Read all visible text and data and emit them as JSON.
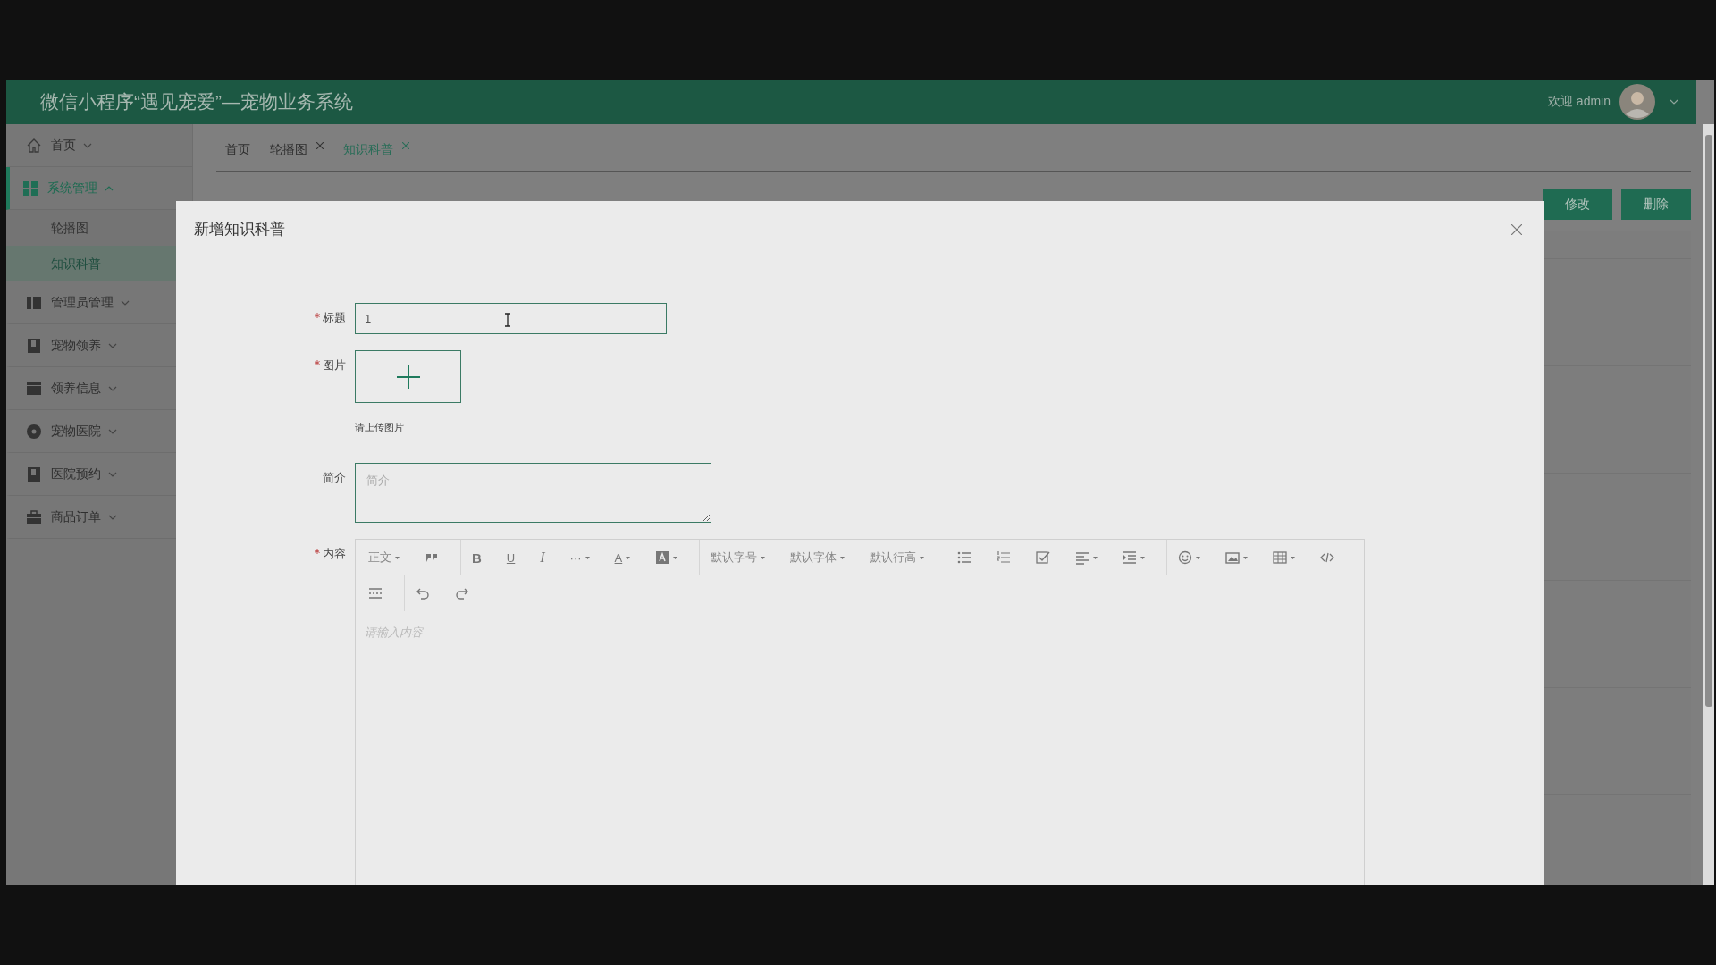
{
  "header": {
    "title": "微信小程序“遇见宠爱”—宠物业务系统",
    "welcome": "欢迎 admin"
  },
  "sidebar": {
    "items": [
      {
        "label": "首页",
        "selected": false,
        "expanded": false
      },
      {
        "label": "系统管理",
        "selected": true,
        "expanded": true,
        "children": [
          {
            "label": "轮播图",
            "selected": false
          },
          {
            "label": "知识科普",
            "selected": true
          }
        ]
      },
      {
        "label": "管理员管理",
        "selected": false,
        "expanded": false
      },
      {
        "label": "宠物领养",
        "selected": false,
        "expanded": false
      },
      {
        "label": "领养信息",
        "selected": false,
        "expanded": false
      },
      {
        "label": "宠物医院",
        "selected": false,
        "expanded": false
      },
      {
        "label": "医院预约",
        "selected": false,
        "expanded": false
      },
      {
        "label": "商品订单",
        "selected": false,
        "expanded": false
      }
    ]
  },
  "tabs": [
    {
      "label": "首页",
      "selected": false,
      "closable": false
    },
    {
      "label": "轮播图",
      "selected": false,
      "closable": true
    },
    {
      "label": "知识科普",
      "selected": true,
      "closable": true
    }
  ],
  "actions": [
    "修改",
    "删除"
  ],
  "dialog": {
    "title": "新增知识科普",
    "fields": [
      {
        "kind": "text",
        "label": "标题",
        "required": true,
        "value": "1"
      },
      {
        "kind": "upload",
        "label": "图片",
        "required": true,
        "hint": "请上传图片"
      },
      {
        "kind": "textarea",
        "label": "简介",
        "required": false,
        "placeholder": "简介"
      },
      {
        "kind": "editor",
        "label": "内容",
        "required": true,
        "placeholder": "请输入内容",
        "toolbar": [
          [
            {
              "kind": "dropdown",
              "label": "正文"
            },
            {
              "kind": "icon",
              "caret": false
            },
            {
              "kind": "separator"
            },
            {
              "kind": "glyph",
              "label": "B",
              "caret": false
            },
            {
              "kind": "glyph",
              "label": "U",
              "caret": false
            },
            {
              "kind": "glyph",
              "label": "I",
              "caret": false
            },
            {
              "kind": "glyph",
              "label": "···",
              "caret": true
            },
            {
              "kind": "glyph",
              "label": "A",
              "caret": true
            },
            {
              "kind": "icon",
              "caret": true
            },
            {
              "kind": "separator"
            },
            {
              "kind": "dropdown",
              "label": "默认字号"
            },
            {
              "kind": "dropdown",
              "label": "默认字体"
            },
            {
              "kind": "dropdown",
              "label": "默认行高"
            },
            {
              "kind": "separator"
            },
            {
              "kind": "icon",
              "caret": false
            },
            {
              "kind": "icon",
              "caret": false
            },
            {
              "kind": "icon",
              "caret": false
            },
            {
              "kind": "icon",
              "caret": true
            },
            {
              "kind": "icon",
              "caret": true
            },
            {
              "kind": "separator"
            },
            {
              "kind": "icon",
              "caret": true
            },
            {
              "kind": "icon",
              "caret": true
            },
            {
              "kind": "icon",
              "caret": true
            },
            {
              "kind": "icon",
              "caret": false
            }
          ],
          [
            {
              "kind": "icon",
              "caret": false
            },
            {
              "kind": "separator"
            },
            {
              "kind": "icon",
              "caret": false
            },
            {
              "kind": "icon",
              "caret": false
            }
          ]
        ]
      }
    ]
  }
}
